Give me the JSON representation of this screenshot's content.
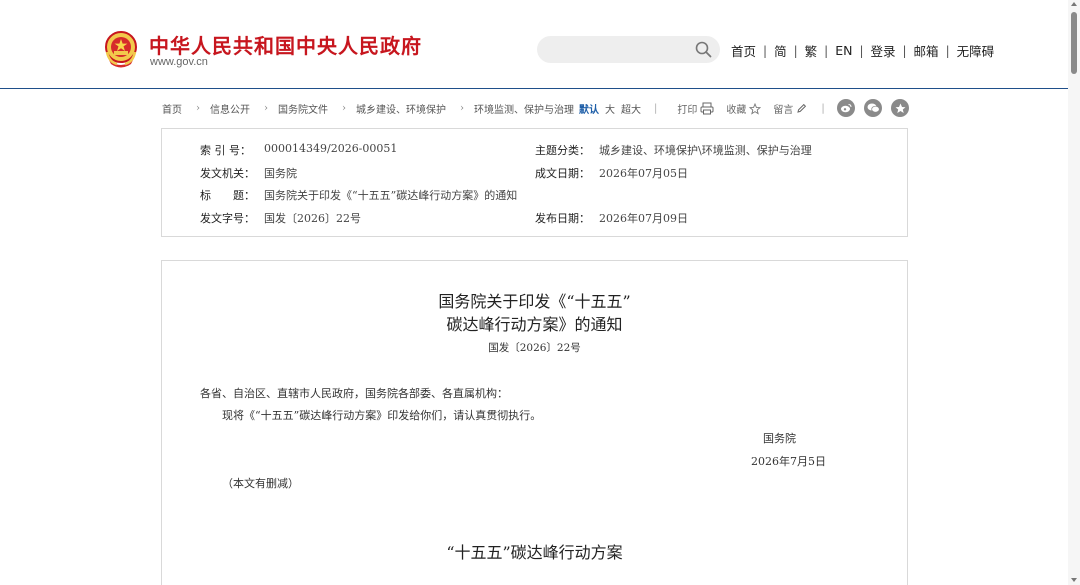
{
  "header": {
    "site_name": "中华人民共和国中央人民政府",
    "site_url": "www.gov.cn",
    "search_placeholder": "",
    "nav": [
      "首页",
      "简",
      "繁",
      "EN",
      "登录",
      "邮箱",
      "无障碍"
    ],
    "nav_separator": "|"
  },
  "breadcrumb": {
    "items": [
      "首页",
      "信息公开",
      "国务院文件",
      "城乡建设、环境保护",
      "环境监测、保护与治理"
    ],
    "font_size_options": [
      "默认",
      "大",
      "超大"
    ],
    "active_font_size": "默认"
  },
  "tools": {
    "print": "打印",
    "favorite": "收藏",
    "comment": "留言",
    "separator": "|"
  },
  "share_icons": [
    "weibo-icon",
    "wechat-icon",
    "qzone-icon"
  ],
  "meta": {
    "index_label": "索 引 号：",
    "index_value": "000014349/2026-00051",
    "topic_label": "主题分类：",
    "topic_value": "城乡建设、环境保护\\环境监测、保护与治理",
    "issuer_label": "发文机关：",
    "issuer_value": "国务院",
    "written_label": "成文日期：",
    "written_value": "2026年07月05日",
    "title_label": "标　　题：",
    "title_value": "国务院关于印发《“十五五”碳达峰行动方案》的通知",
    "docnum_label": "发文字号：",
    "docnum_value": "国发〔2026〕22号",
    "published_label": "发布日期：",
    "published_value": "2026年07月09日"
  },
  "document": {
    "title_line1": "国务院关于印发《“十五五”",
    "title_line2": "碳达峰行动方案》的通知",
    "doc_number": "国发〔2026〕22号",
    "salutation": "各省、自治区、直辖市人民政府，国务院各部委、各直属机构：",
    "body": "现将《“十五五”碳达峰行动方案》印发给你们，请认真贯彻执行。",
    "signature": "国务院",
    "date": "2026年7月5日",
    "note": "（本文有删减）",
    "plan_title": "“十五五”碳达峰行动方案"
  },
  "colors": {
    "brand_red": "#c7161e",
    "header_line": "#1f4f8a",
    "active_link": "#1f5fa8"
  }
}
